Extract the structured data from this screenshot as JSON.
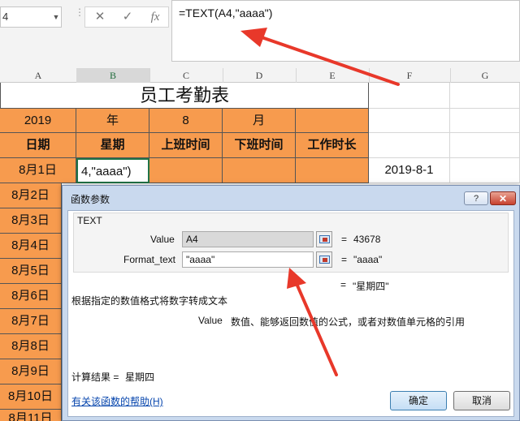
{
  "namebox": {
    "value": "4"
  },
  "formula_bar": {
    "cancel_icon": "✕",
    "confirm_icon": "✓",
    "fx_icon": "fx",
    "formula": "=TEXT(A4,\"aaaa\")"
  },
  "columns": [
    "A",
    "B",
    "C",
    "D",
    "E",
    "F",
    "G"
  ],
  "sheet": {
    "title": "员工考勤表",
    "row2": [
      "2019",
      "年",
      "8",
      "月",
      ""
    ],
    "headers": [
      "日期",
      "星期",
      "上班时间",
      "下班时间",
      "工作时长"
    ],
    "row4_b": "4,\"aaaa\")",
    "row4_f": "2019-8-1",
    "dates": [
      "8月1日",
      "8月2日",
      "8月3日",
      "8月4日",
      "8月5日",
      "8月6日",
      "8月7日",
      "8月8日",
      "8月9日",
      "8月10日",
      "8月11日"
    ]
  },
  "dialog": {
    "title": "函数参数",
    "help_button": "?",
    "close_button": "✕",
    "function_name": "TEXT",
    "value_label": "Value",
    "value_input": "A4",
    "value_result": "43678",
    "format_label": "Format_text",
    "format_input": "\"aaaa\"",
    "format_result": "\"aaaa\"",
    "equals": "=",
    "formula_result": "\"星期四\"",
    "description": "根据指定的数值格式将数字转成文本",
    "arg_description_name": "Value",
    "arg_description": "数值、能够返回数值的公式，或者对数值单元格的引用",
    "calc_result_label": "计算结果 =",
    "calc_result": "星期四",
    "help_link": "有关该函数的帮助(H)",
    "ok": "确定",
    "cancel": "取消"
  },
  "colors": {
    "header_fill": "#f79b4e",
    "arrow": "#e8382a",
    "dialog_frame": "#c9d9ee"
  }
}
